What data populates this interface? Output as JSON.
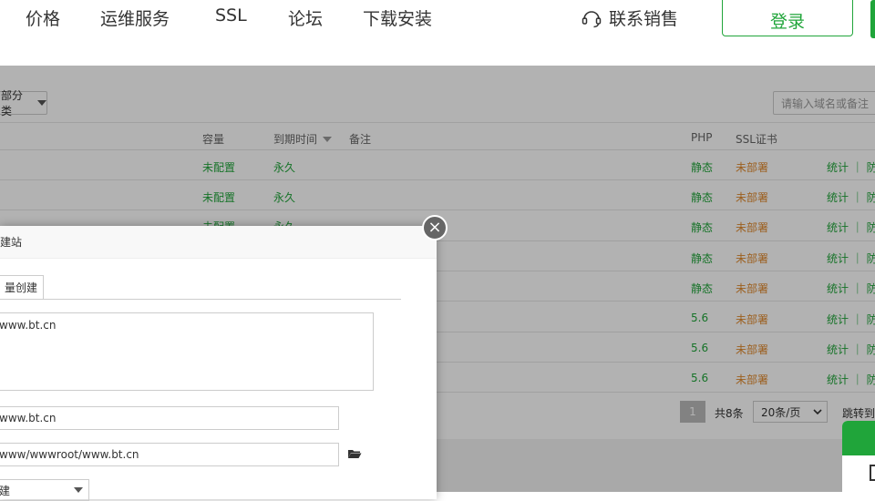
{
  "nav": {
    "items": [
      "价格",
      "运维服务",
      "SSL",
      "论坛",
      "下载安装"
    ],
    "contact": "联系销售",
    "login": "登录"
  },
  "toolbar": {
    "category": "部分类",
    "search_placeholder": "请输入域名或备注"
  },
  "table": {
    "headers": {
      "capacity": "容量",
      "expire": "到期时间",
      "note": "备注",
      "php": "PHP",
      "ssl": "SSL证书"
    },
    "rows": [
      {
        "capacity": "未配置",
        "expire": "永久",
        "php": "静态",
        "ssl": "未部署",
        "actions": "统计 ｜ 防"
      },
      {
        "capacity": "未配置",
        "expire": "永久",
        "php": "静态",
        "ssl": "未部署",
        "actions": "统计 ｜ 防"
      },
      {
        "capacity": "未配置",
        "expire": "永久",
        "php": "静态",
        "ssl": "未部署",
        "actions": "统计 ｜ 防"
      },
      {
        "capacity": "",
        "expire": "",
        "php": "静态",
        "ssl": "未部署",
        "actions": "统计 ｜ 防"
      },
      {
        "capacity": "",
        "expire": "",
        "php": "静态",
        "ssl": "未部署",
        "actions": "统计 ｜ 防"
      },
      {
        "capacity": "",
        "expire": "",
        "php": "5.6",
        "ssl": "未部署",
        "actions": "统计 ｜ 防"
      },
      {
        "capacity": "",
        "expire": "",
        "php": "5.6",
        "ssl": "未部署",
        "actions": "统计 ｜ 防"
      },
      {
        "capacity": "",
        "expire": "",
        "php": "5.6",
        "ssl": "未部署",
        "actions": "统计 ｜ 防"
      }
    ]
  },
  "pager": {
    "current": "1",
    "total": "共8条",
    "page_size": "20条/页",
    "jump": "跳转到"
  },
  "modal": {
    "title": "建站",
    "tab": "量创建",
    "domains_value": "www.bt.cn",
    "remark_value": "www.bt.cn",
    "path_value": "www/wwwroot/www.bt.cn",
    "select_value": "建"
  },
  "colors": {
    "brand": "#20a53a",
    "warning": "#e0892c"
  }
}
